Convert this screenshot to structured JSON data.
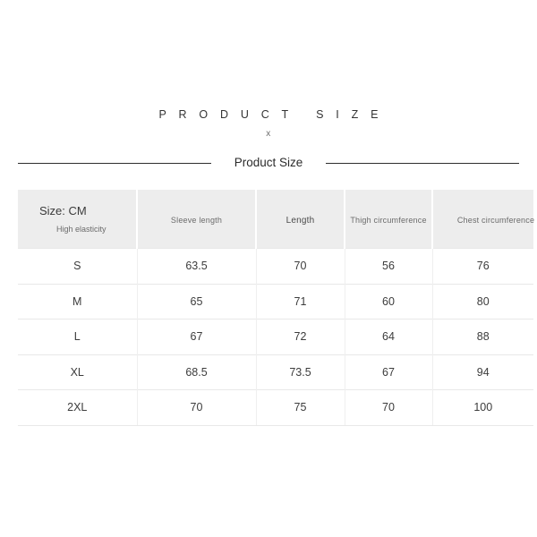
{
  "header": {
    "main_title": "P R O D U C T   S I Z E",
    "sub_mark": "x",
    "divider_label": "Product Size"
  },
  "table": {
    "columns": [
      {
        "key": "size",
        "label_primary": "Size: CM",
        "label_secondary": "High elasticity"
      },
      {
        "key": "sleeve_length",
        "label": "Sleeve length"
      },
      {
        "key": "length",
        "label": "Length"
      },
      {
        "key": "thigh_circumference",
        "label": "Thigh circumference"
      },
      {
        "key": "chest_circumference",
        "label": "Chest circumference"
      }
    ],
    "rows": [
      {
        "size": "S",
        "sleeve_length": "63.5",
        "length": "70",
        "thigh_circumference": "56",
        "chest_circumference": "76"
      },
      {
        "size": "M",
        "sleeve_length": "65",
        "length": "71",
        "thigh_circumference": "60",
        "chest_circumference": "80"
      },
      {
        "size": "L",
        "sleeve_length": "67",
        "length": "72",
        "thigh_circumference": "64",
        "chest_circumference": "88"
      },
      {
        "size": "XL",
        "sleeve_length": "68.5",
        "length": "73.5",
        "thigh_circumference": "67",
        "chest_circumference": "94"
      },
      {
        "size": "2XL",
        "sleeve_length": "70",
        "length": "75",
        "thigh_circumference": "70",
        "chest_circumference": "100"
      }
    ]
  },
  "colors": {
    "page_background": "#ffffff",
    "header_row_background": "#ededed",
    "divider_line": "#2e2e2e",
    "body_text": "#3c3c3c",
    "muted_text": "#6b6b6b",
    "cell_border": "#e8e8e8"
  }
}
